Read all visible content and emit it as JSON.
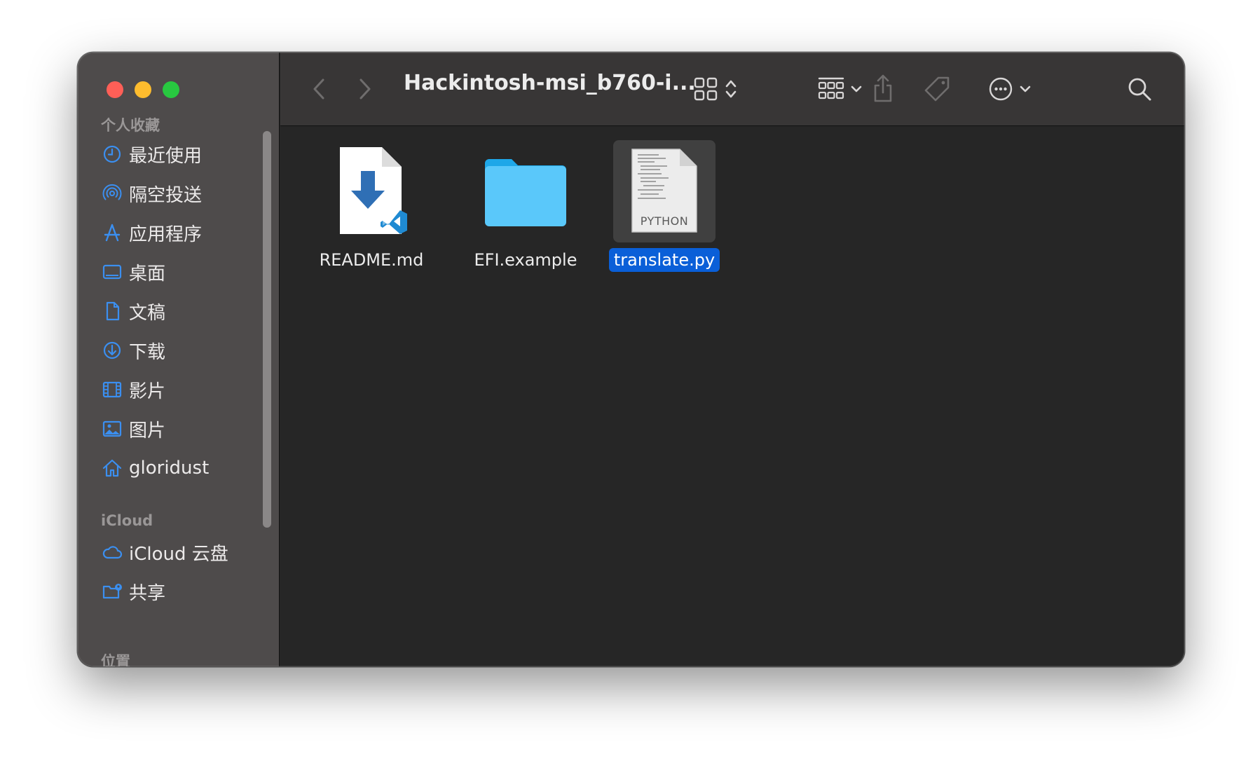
{
  "sidebar": {
    "favorites_title": "个人收藏",
    "favorites": [
      {
        "label": "最近使用",
        "icon": "clock-icon"
      },
      {
        "label": "隔空投送",
        "icon": "airdrop-icon"
      },
      {
        "label": "应用程序",
        "icon": "applications-icon"
      },
      {
        "label": "桌面",
        "icon": "desktop-icon"
      },
      {
        "label": "文稿",
        "icon": "document-icon"
      },
      {
        "label": "下载",
        "icon": "download-icon"
      },
      {
        "label": "影片",
        "icon": "film-icon"
      },
      {
        "label": "图片",
        "icon": "photo-icon"
      },
      {
        "label": "gloridust",
        "icon": "home-icon"
      }
    ],
    "icloud_title": "iCloud",
    "icloud": [
      {
        "label": "iCloud 云盘",
        "icon": "cloud-icon"
      },
      {
        "label": "共享",
        "icon": "shared-folder-icon"
      }
    ],
    "locations_title": "位置"
  },
  "toolbar": {
    "path_title": "Hackintosh-msi_b760-i..."
  },
  "files": [
    {
      "name": "README.md",
      "kind": "markdown-vscode-icon",
      "selected": false
    },
    {
      "name": "EFI.example",
      "kind": "folder-icon",
      "selected": false
    },
    {
      "name": "translate.py",
      "kind": "python-file-icon",
      "badge": "PYTHON",
      "selected": true
    }
  ],
  "colors": {
    "accent": "#0a5fd8",
    "sidebar_icon": "#3b8ff0",
    "folder": "#5ac8fa"
  }
}
